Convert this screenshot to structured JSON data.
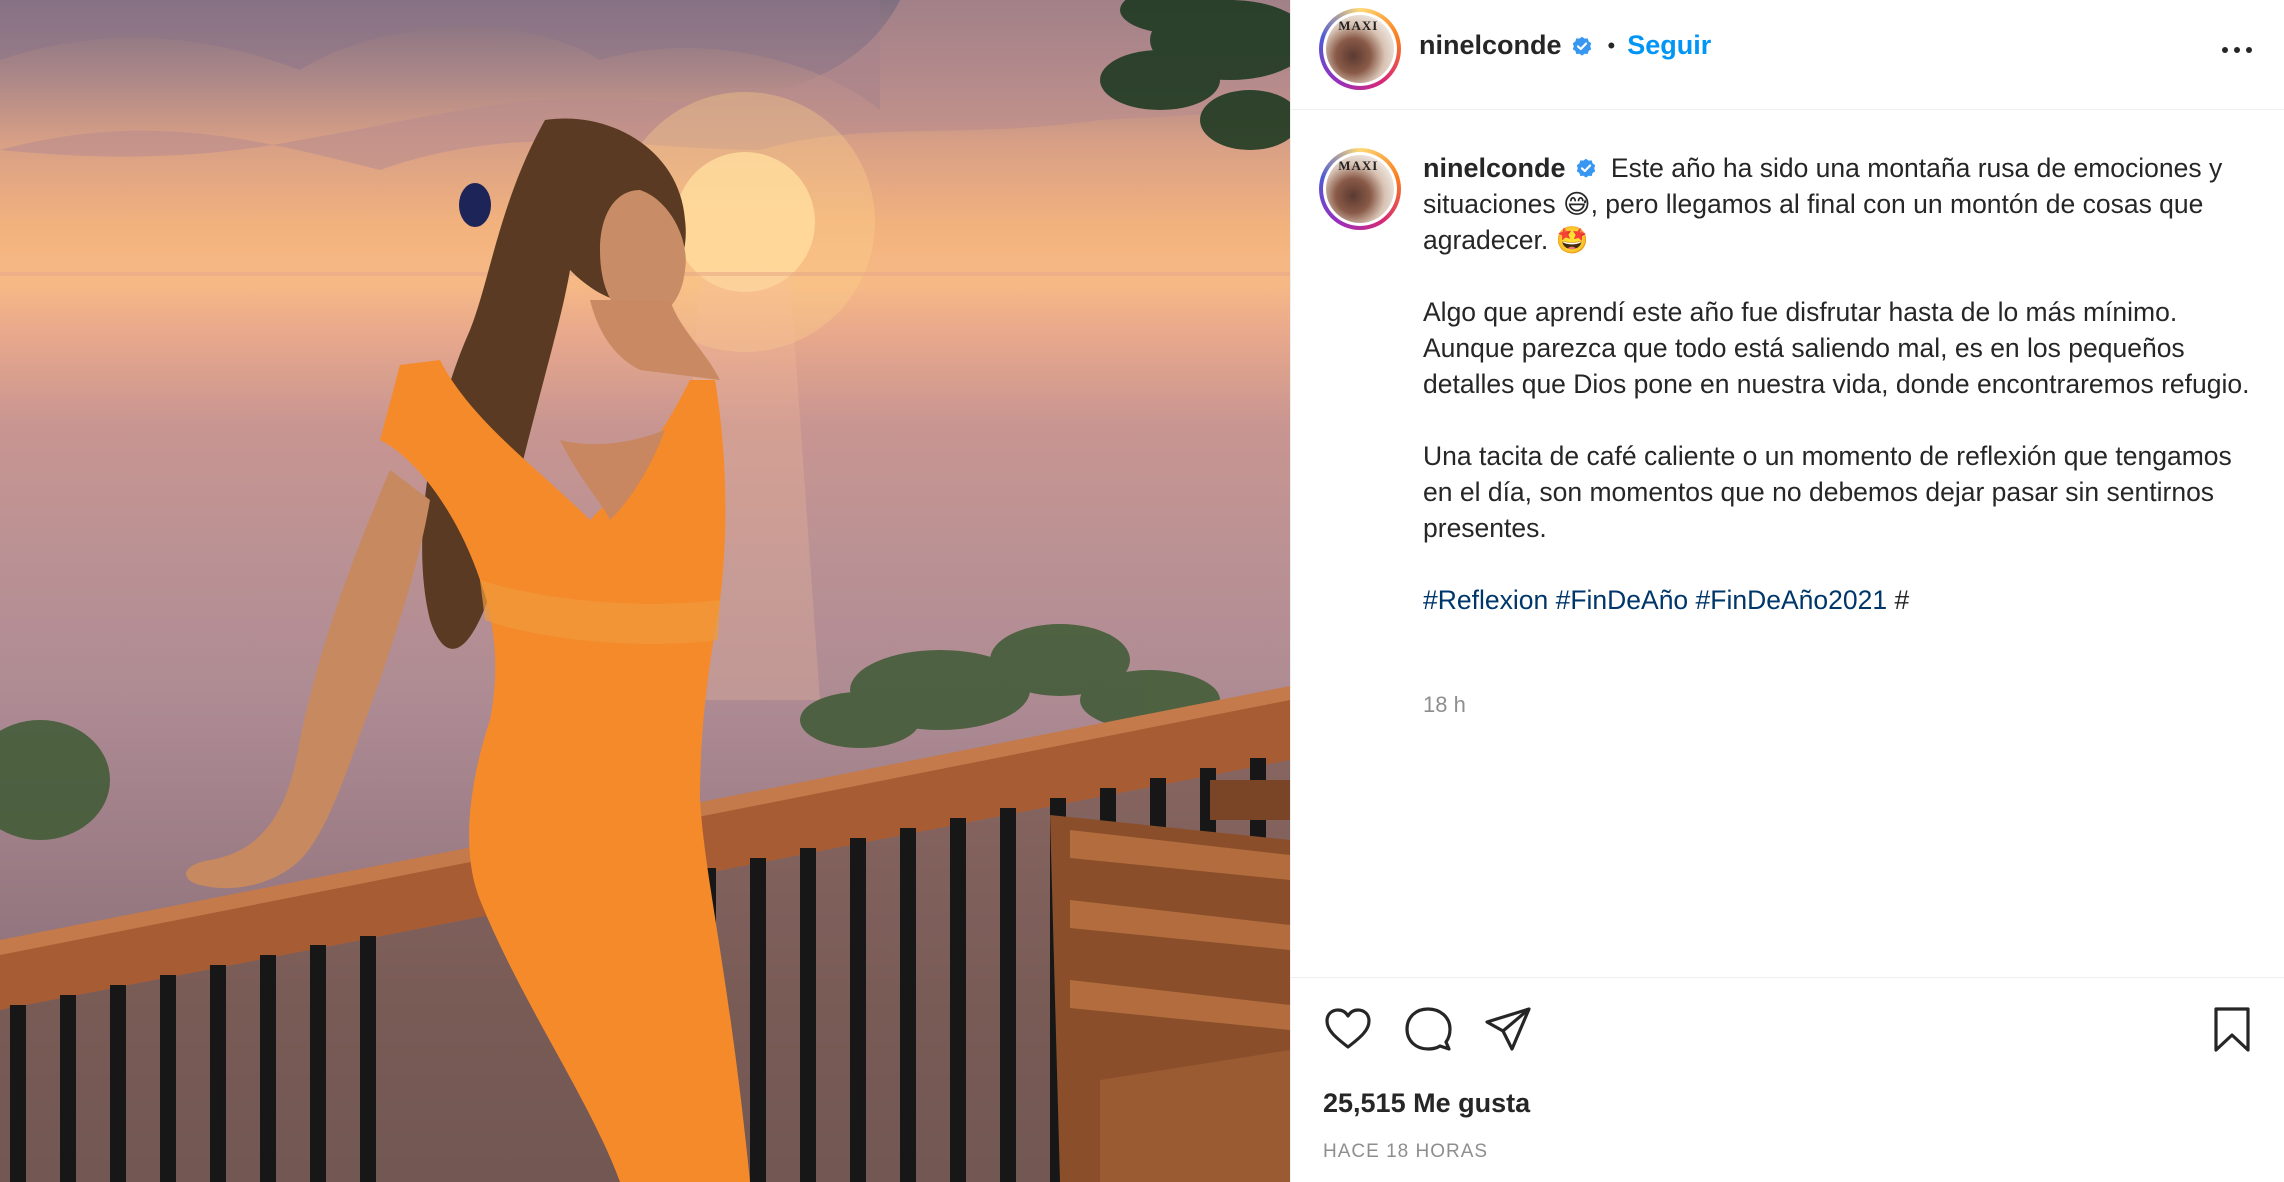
{
  "post": {
    "username": "ninelconde",
    "verified": true,
    "follow_label": "Seguir",
    "caption_paragraphs": [
      "Este año ha sido una montaña rusa de emociones y situaciones 😅, pero llegamos al final con un montón de cosas que agradecer. 🤩",
      "Algo que aprendí este año fue disfrutar hasta de lo más mínimo. Aunque parezca que todo está saliendo mal, es en los pequeños detalles que Dios pone en nuestra vida, donde encontraremos refugio.",
      "Una tacita de café caliente o un momento de reflexión que tengamos en el día, son momentos que no debemos dejar pasar sin sentirnos presentes."
    ],
    "hashtags": [
      "#Reflexion",
      "#FinDeAño",
      "#FinDeAño2021",
      "#"
    ],
    "caption_time": "18 h",
    "likes": "25,515 Me gusta",
    "posted_ago": "HACE 18 HORAS"
  },
  "icons": {
    "verified": "verified-badge-icon",
    "more": "more-options-icon",
    "like": "heart-icon",
    "comment": "comment-icon",
    "share": "send-icon",
    "save": "bookmark-icon"
  },
  "colors": {
    "accent": "#0095f6",
    "hashtag": "#00376b",
    "muted": "#8e8e8e",
    "text": "#262626",
    "dress": "#f58a2a"
  }
}
